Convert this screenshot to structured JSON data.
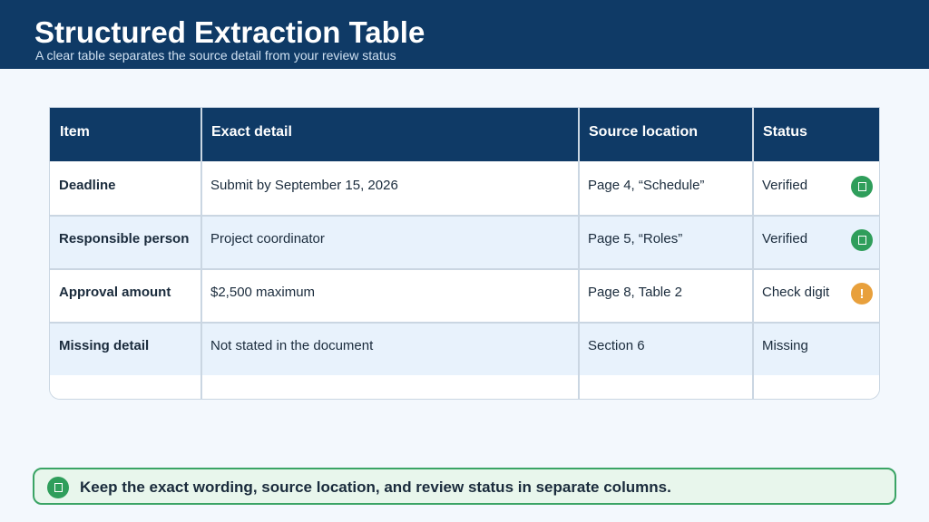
{
  "header": {
    "title": "Structured Extraction Table",
    "subtitle": "A clear table separates the source detail from your review status"
  },
  "table": {
    "columns": [
      "Item",
      "Exact detail",
      "Source location",
      "Status"
    ],
    "rows": [
      {
        "item": "Deadline",
        "detail": "Submit by September 15, 2026",
        "source": "Page 4, “Schedule”",
        "status": "Verified",
        "icon": "check-icon",
        "icon_color": "#2f9e5b"
      },
      {
        "item": "Responsible person",
        "detail": "Project coordinator",
        "source": "Page 5, “Roles”",
        "status": "Verified",
        "icon": "check-icon",
        "icon_color": "#2f9e5b"
      },
      {
        "item": "Approval amount",
        "detail": "$2,500 maximum",
        "source": "Page 8, Table 2",
        "status": "Check digit",
        "icon": "warning-icon",
        "icon_symbol": "!",
        "icon_color": "#e8a03c"
      },
      {
        "item": "Missing detail",
        "detail": "Not stated in the document",
        "source": "Section 6",
        "status": "Missing"
      }
    ]
  },
  "callout": {
    "text": "Keep the exact wording, source location, and review status in separate columns.",
    "icon": "check-icon"
  },
  "colors": {
    "header_bg": "#0f3a66",
    "row_alt": "#e8f2fc",
    "verified": "#2f9e5b",
    "warning": "#e8a03c",
    "callout_bg": "#e8f6ec",
    "callout_border": "#3aa465"
  }
}
